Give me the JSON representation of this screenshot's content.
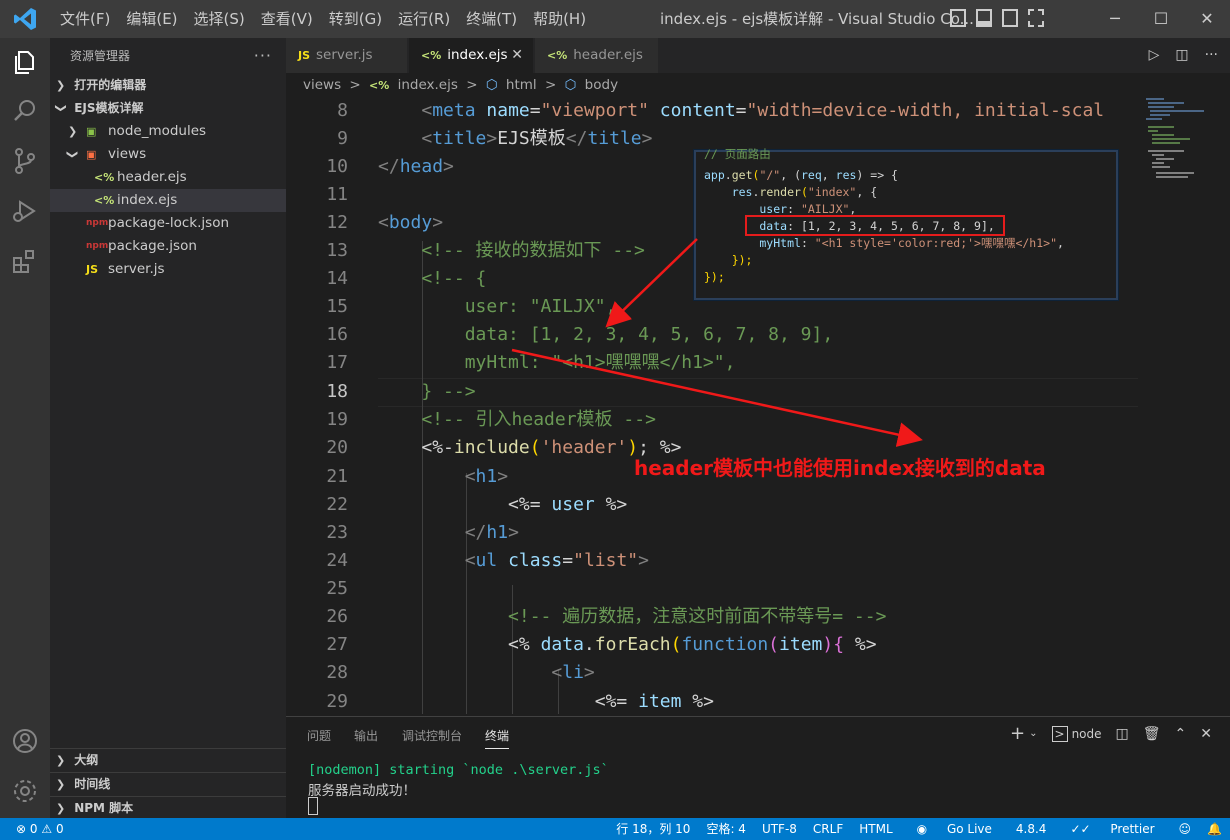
{
  "window": {
    "title": "index.ejs - ejs模板详解 - Visual Studio Co...",
    "menu": [
      "文件(F)",
      "编辑(E)",
      "选择(S)",
      "查看(V)",
      "转到(G)",
      "运行(R)",
      "终端(T)",
      "帮助(H)"
    ],
    "controls": {
      "minimize": "─",
      "maximize": "☐",
      "close": "✕"
    }
  },
  "sidebar": {
    "title": "资源管理器",
    "more": "···",
    "open_editors": "打开的编辑器",
    "project": "EJS模板详解",
    "tree": [
      {
        "label": "node_modules",
        "icon": "▣",
        "type": "folder"
      },
      {
        "label": "views",
        "icon": "▣",
        "type": "folder-open"
      },
      {
        "label": "header.ejs",
        "icon": "<%",
        "type": "file"
      },
      {
        "label": "index.ejs",
        "icon": "<%",
        "type": "file"
      },
      {
        "label": "package-lock.json",
        "icon": "npm",
        "type": "file"
      },
      {
        "label": "package.json",
        "icon": "npm",
        "type": "file"
      },
      {
        "label": "server.js",
        "icon": "JS",
        "type": "file"
      }
    ],
    "outline": "大纲",
    "timeline": "时间线",
    "npm": "NPM 脚本"
  },
  "tabs": [
    {
      "label": "server.js",
      "icon": "JS"
    },
    {
      "label": "index.ejs",
      "icon": "<%"
    },
    {
      "label": "header.ejs",
      "icon": "<%"
    }
  ],
  "breadcrumbs": {
    "views": "views",
    "sep": ">",
    "file": "index.ejs",
    "html": "html",
    "body": "body"
  },
  "editor": {
    "line_numbers": [
      "8",
      "9",
      "10",
      "11",
      "12",
      "13",
      "14",
      "15",
      "16",
      "17",
      "18",
      "19",
      "20",
      "21",
      "22",
      "23",
      "24",
      "25",
      "26",
      "27",
      "28",
      "29"
    ],
    "lines": {
      "l8": {
        "indent": "    ",
        "a": "<",
        "b": "meta",
        "c": " name",
        "d": "=",
        "e": "\"viewport\"",
        "f": " content",
        "g": "=",
        "h": "\"width=device-width, initial-scal"
      },
      "l9": {
        "indent": "    ",
        "a": "<",
        "b": "title",
        "c": ">",
        "d": "EJS模板",
        "e": "</",
        "f": "title",
        "g": ">"
      },
      "l10": {
        "a": "</",
        "b": "head",
        "c": ">"
      },
      "l12": {
        "a": "<",
        "b": "body",
        "c": ">"
      },
      "l13": {
        "text": "    <!-- 接收的数据如下 -->"
      },
      "l14": {
        "text": "    <!-- {"
      },
      "l15": {
        "text": "        user: \"AILJX\","
      },
      "l16": {
        "text": "        data: [1, 2, 3, 4, 5, 6, 7, 8, 9],"
      },
      "l17": {
        "text": "        myHtml: \"<h1>嘿嘿嘿</h1>\","
      },
      "l18": {
        "text": "    } -->"
      },
      "l19": {
        "text": "    <!-- 引入header模板 -->"
      },
      "l20": {
        "indent": "    ",
        "a": "<%-",
        "b": "include",
        "c": "(",
        "d": "'header'",
        "e": ")",
        "f": "; %>"
      },
      "l21": {
        "indent": "        ",
        "a": "<",
        "b": "h1",
        "c": ">"
      },
      "l22": {
        "indent": "            ",
        "a": "<%=",
        "b": " user",
        "c": " %>"
      },
      "l23": {
        "indent": "        ",
        "a": "</",
        "b": "h1",
        "c": ">"
      },
      "l24": {
        "indent": "        ",
        "a": "<",
        "b": "ul",
        "c": " class",
        "d": "=",
        "e": "\"list\"",
        "f": ">"
      },
      "l26": {
        "text": "            <!-- 遍历数据，注意这时前面不带等号= -->"
      },
      "l27": {
        "indent": "            ",
        "a": "<%",
        "b": " data",
        "c": ".",
        "d": "forEach",
        "e": "(",
        "f": "function",
        "g": "(",
        "h": "item",
        "i": "){",
        "j": " %>"
      },
      "l28": {
        "indent": "                ",
        "a": "<",
        "b": "li",
        "c": ">"
      },
      "l29": {
        "indent": "                    ",
        "a": "<%=",
        "b": " item",
        "c": " %>"
      }
    }
  },
  "snippet": {
    "comment": "// 页面路由",
    "l1": {
      "a": "app",
      "b": ".",
      "c": "get",
      "d": "(",
      "e": "\"/\"",
      "f": ", (",
      "g": "req",
      "h": ", ",
      "i": "res",
      "j": ") => {"
    },
    "l2": {
      "a": "    res",
      "b": ".",
      "c": "render",
      "d": "(",
      "e": "\"index\"",
      "f": ", {"
    },
    "l3": {
      "a": "        user",
      "b": ": ",
      "c": "\"AILJX\"",
      "d": ","
    },
    "l4": {
      "a": "        data",
      "b": ": [1, 2, 3, 4, 5, 6, 7, 8, 9],"
    },
    "l5": {
      "a": "        myHtml",
      "b": ": ",
      "c": "\"<h1 style='color:red;'>嘿嘿嘿</h1>\"",
      "d": ","
    },
    "l6": "    });",
    "l7": "});"
  },
  "annotation": "header模板中也能使用index接收到的data",
  "panel": {
    "tabs": [
      "问题",
      "输出",
      "调试控制台",
      "终端"
    ],
    "shell": "node",
    "terminal": [
      "[nodemon] starting `node .\\server.js`",
      "服务器启动成功！"
    ]
  },
  "statusbar": {
    "errors": "0",
    "warnings": "0",
    "position": "行 18，列 10",
    "spaces": "空格: 4",
    "encoding": "UTF-8",
    "eol": "CRLF",
    "language": "HTML",
    "golive": "Go Live",
    "version": "4.8.4",
    "prettier": "Prettier"
  },
  "colors": {
    "accent": "#007acc",
    "annotation": "#f01919"
  }
}
